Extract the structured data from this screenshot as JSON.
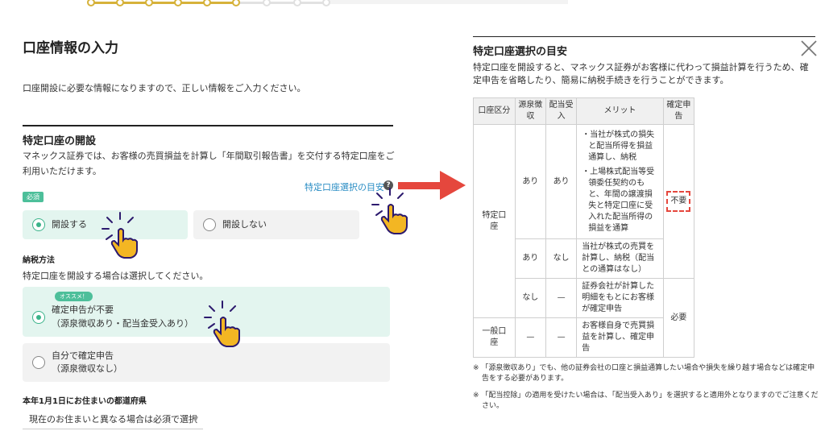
{
  "progress": {
    "total_steps": 9,
    "completed_steps": 6,
    "accent": "#d6b23a"
  },
  "form": {
    "title": "口座情報の入力",
    "intro": "口座開設に必要な情報になりますので、正しい情報をご入力ください。",
    "section_title": "特定口座の開設",
    "section_desc": "マネックス証券では、お客様の売買損益を計算し「年間取引報告書」を交付する特定口座をご利用いただけます。",
    "guide_link": "特定口座選択の目安",
    "required_badge": "必須",
    "open_options": [
      {
        "label": "開設する",
        "selected": true
      },
      {
        "label": "開設しない",
        "selected": false
      }
    ],
    "tax_method_title": "納税方法",
    "tax_method_desc": "特定口座を開設する場合は選択してください。",
    "recommend_badge": "オススメ！",
    "tax_options": [
      {
        "line1": "確定申告が不要",
        "line2": "（源泉徴収あり・配当金受入あり）",
        "selected": true
      },
      {
        "line1": "自分で確定申告",
        "line2": "（源泉徴収なし）",
        "selected": false
      }
    ],
    "prefecture_title": "本年1月1日にお住まいの都道府県",
    "prefecture_select": "現在のお住まいと異なる場合は必須で選択"
  },
  "guide_panel": {
    "title": "特定口座選択の目安",
    "description": "特定口座を開設すると、マネックス証券がお客様に代わって損益計算を行うため、確定申告を省略したり、簡易に納税手続きを行うことができます。",
    "table": {
      "headers": [
        "口座区分",
        "源泉徴収",
        "配当受入",
        "メリット",
        "確定申告"
      ],
      "rows": {
        "tokutei_label": "特定口座",
        "ippan_label": "一般口座",
        "r1_gensen": "あり",
        "r1_haito": "あり",
        "r1_merit1": "・当社が株式の損失と配当所得を損益通算し、納税",
        "r1_merit2": "・上場株式配当等受領委任契約のもと、年間の譲渡損失と特定口座に受入れた配当所得の損益を通算",
        "r1_kakutei": "不要",
        "r2_gensen": "あり",
        "r2_haito": "なし",
        "r2_merit": "当社が株式の売買を計算し、納税（配当との通算はなし）",
        "r3_gensen": "なし",
        "r3_haito": "—",
        "r3_merit": "証券会社が計算した明細をもとにお客様が確定申告",
        "r34_kakutei": "必要",
        "r4_gensen": "—",
        "r4_haito": "—",
        "r4_merit": "お客様自身で売買損益を計算し、確定申告"
      }
    },
    "note1": "※ 「源泉徴収あり」でも、他の証券会社の口座と損益通算したい場合や損失を繰り越す場合などは確定申告をする必要があります。",
    "note2": "※ 「配当控除」の適用を受けたい場合は、「配当受入あり」を選択すると適用外となりますのでご注意ください。"
  },
  "colors": {
    "accent_green": "#3bb38a",
    "arrow_red": "#e5473d",
    "link_blue": "#2a8dc4",
    "hand_yellow": "#f3b623"
  }
}
